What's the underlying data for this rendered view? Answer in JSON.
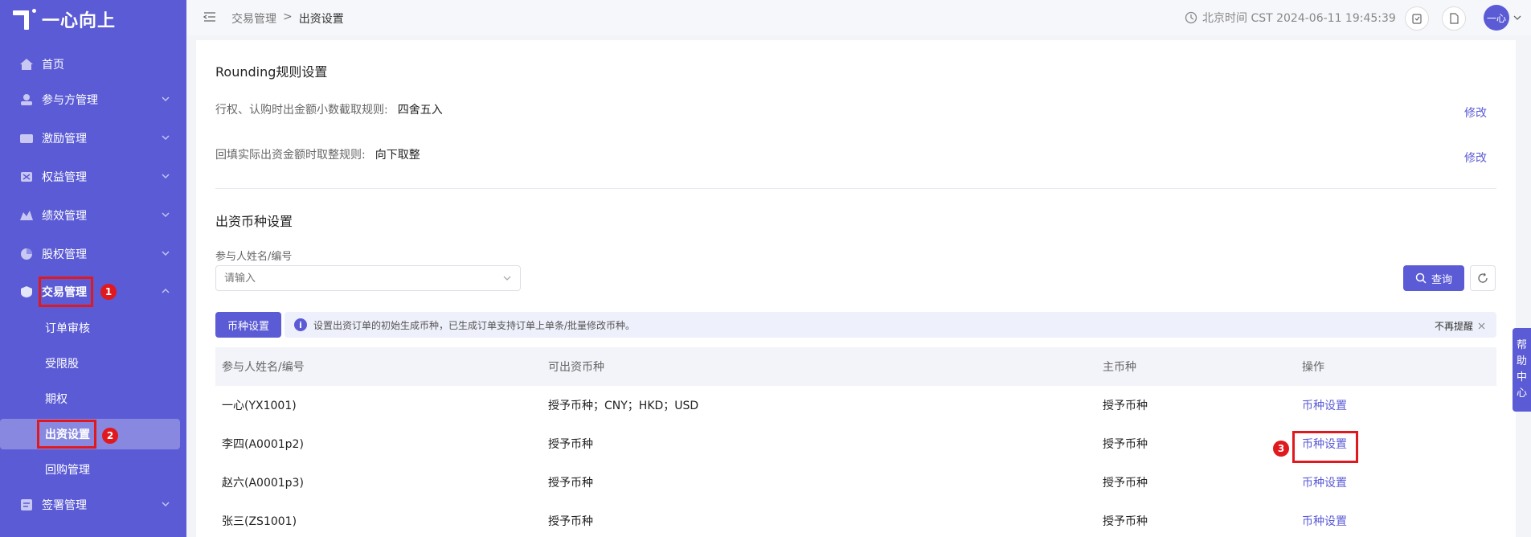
{
  "app": {
    "logo_text": "一心向上"
  },
  "sidebar": {
    "items": [
      {
        "label": "首页",
        "icon": "home-icon"
      },
      {
        "label": "参与方管理",
        "icon": "participants-icon"
      },
      {
        "label": "激励管理",
        "icon": "incentive-icon"
      },
      {
        "label": "权益管理",
        "icon": "rights-icon"
      },
      {
        "label": "绩效管理",
        "icon": "performance-icon"
      },
      {
        "label": "股权管理",
        "icon": "equity-icon"
      },
      {
        "label": "交易管理",
        "icon": "trade-icon"
      },
      {
        "label": "签署管理",
        "icon": "sign-icon"
      }
    ],
    "sub_items": [
      {
        "label": "订单审核"
      },
      {
        "label": "受限股"
      },
      {
        "label": "期权"
      },
      {
        "label": "出资设置"
      },
      {
        "label": "回购管理"
      }
    ]
  },
  "header": {
    "breadcrumb": [
      "交易管理",
      ">",
      "出资设置"
    ],
    "clock_text": "北京时间 CST 2024-06-11 19:45:39",
    "avatar_text": "一心"
  },
  "rounding": {
    "title": "Rounding规则设置",
    "rule1_label": "行权、认购时出金额小数截取规则:",
    "rule1_value": "四舍五入",
    "rule2_label": "回填实际出资金额时取整规则:",
    "rule2_value": "向下取整",
    "edit_label": "修改"
  },
  "currency": {
    "title": "出资币种设置",
    "field_label": "参与人姓名/编号",
    "placeholder": "请输入",
    "query_label": "查询",
    "set_button": "币种设置",
    "notice_text": "设置出资订单的初始生成币种，已生成订单支持订单上单条/批量修改币种。",
    "dismiss_text": "不再提醒",
    "columns": [
      "参与人姓名/编号",
      "可出资币种",
      "主币种",
      "操作"
    ],
    "rows": [
      {
        "name": "一心(YX1001)",
        "currencies": "授予币种；CNY；HKD；USD",
        "main": "授予币种",
        "action": "币种设置"
      },
      {
        "name": "李四(A0001p2)",
        "currencies": "授予币种",
        "main": "授予币种",
        "action": "币种设置"
      },
      {
        "name": "赵六(A0001p3)",
        "currencies": "授予币种",
        "main": "授予币种",
        "action": "币种设置"
      },
      {
        "name": "张三(ZS1001)",
        "currencies": "授予币种",
        "main": "授予币种",
        "action": "币种设置"
      }
    ]
  },
  "annotations": [
    "1",
    "2",
    "3"
  ],
  "help_tab": [
    "帮",
    "助",
    "中",
    "心"
  ],
  "colors": {
    "accent": "#5b5bd6",
    "highlight": "#e0191e"
  }
}
